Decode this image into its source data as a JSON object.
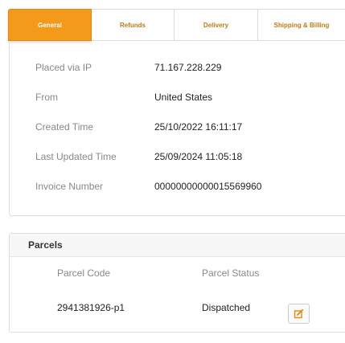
{
  "tabs": [
    {
      "label": "General",
      "active": true
    },
    {
      "label": "Refunds",
      "active": false
    },
    {
      "label": "Delivery",
      "active": false
    },
    {
      "label": "Shipping & Billing",
      "active": false
    }
  ],
  "general": {
    "rows": [
      {
        "label": "Placed via IP",
        "value": "71.167.228.229"
      },
      {
        "label": "From",
        "value": "United States"
      },
      {
        "label": "Created Time",
        "value": "25/10/2022 16:11:17"
      },
      {
        "label": "Last Updated Time",
        "value": "25/09/2024 11:05:18"
      },
      {
        "label": "Invoice Number",
        "value": "00000000000015569960"
      }
    ]
  },
  "parcels": {
    "title": "Parcels",
    "columns": {
      "code": "Parcel Code",
      "status": "Parcel Status"
    },
    "rows": [
      {
        "code": "2941381926-p1",
        "status": "Dispatched"
      }
    ],
    "edit_icon": "edit-icon"
  },
  "colors": {
    "accent": "#f39a1b",
    "tab_text": "#c37b10",
    "label_text": "#888888"
  }
}
